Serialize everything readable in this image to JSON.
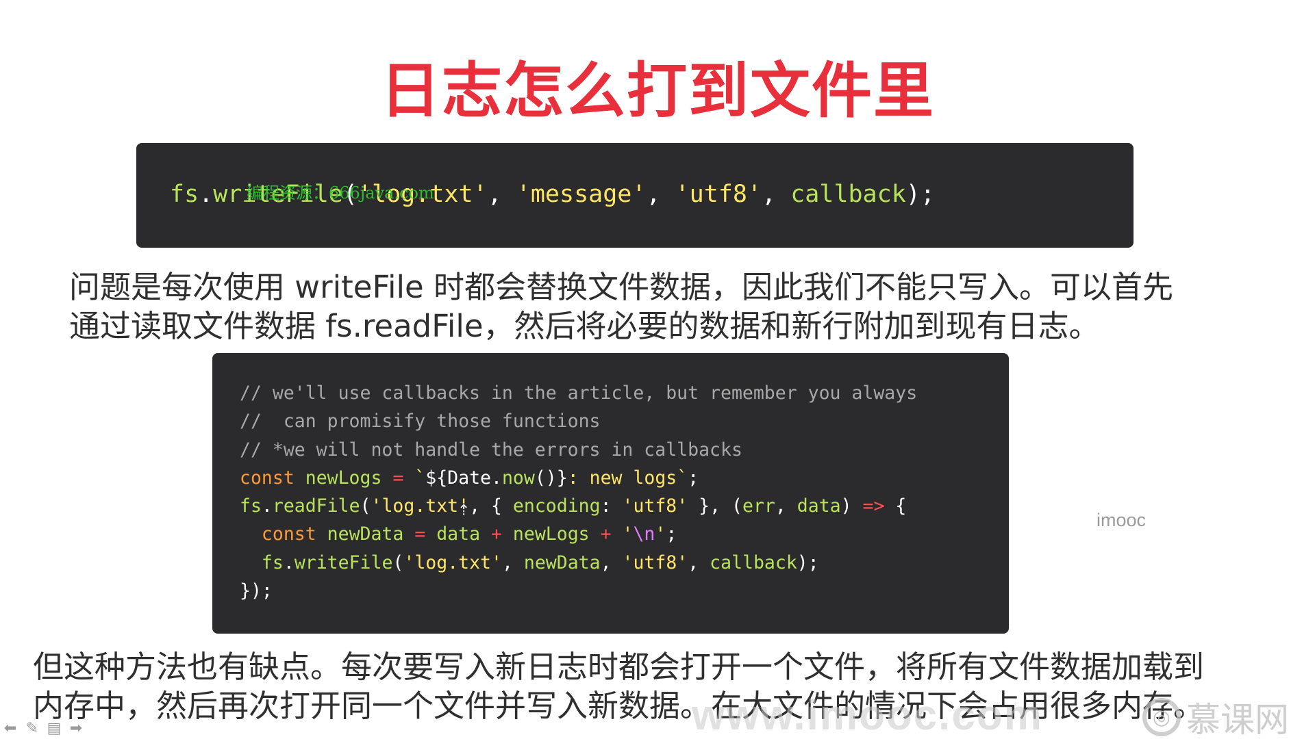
{
  "slide": {
    "title": "日志怎么打到文件里",
    "title_color": "#e8303c",
    "paragraph1": [
      "问题是每次使用 writeFile 时都会替换文件数据，因此我们不能只写入。可以首先",
      "通过读取文件数据 fs.readFile，然后将必要的数据和新行附加到现有日志。"
    ],
    "paragraph2": [
      "但这种方法也有缺点。每次要写入新日志时都会打开一个文件，将所有文件数据加载到",
      "内存中，然后再次打开同一个文件并写入新数据。在大文件的情况下会占用很多内存。"
    ],
    "imooc_mark": "imooc",
    "green_watermark": "编程资源：666java.com",
    "bottom_watermark": "www.imooc.com",
    "brand_watermark": "慕课网"
  },
  "colors": {
    "code_bg": "#2b2b2d",
    "plain": "#ffffff",
    "func": "#b8e35a",
    "string": "#ffe566",
    "keyword": "#ff9933",
    "operator": "#ff4d4d",
    "comment": "#a8a8a8",
    "escape": "#e07bff"
  },
  "code1": [
    [
      [
        "func",
        "fs"
      ],
      [
        "plain",
        "."
      ],
      [
        "func",
        "writeFile"
      ],
      [
        "plain",
        "("
      ],
      [
        "string",
        "'log.txt'"
      ],
      [
        "plain",
        ", "
      ],
      [
        "string",
        "'message'"
      ],
      [
        "plain",
        ", "
      ],
      [
        "string",
        "'utf8'"
      ],
      [
        "plain",
        ", "
      ],
      [
        "func",
        "callback"
      ],
      [
        "plain",
        ");"
      ]
    ]
  ],
  "code2": [
    [
      [
        "comment",
        "// we'll use callbacks in the article, but remember you always"
      ]
    ],
    [
      [
        "comment",
        "//  can promisify those functions"
      ]
    ],
    [
      [
        "comment",
        "// *we will not handle the errors in callbacks"
      ]
    ],
    [
      [
        "keyword",
        "const "
      ],
      [
        "func",
        "newLogs"
      ],
      [
        "operator",
        " = "
      ],
      [
        "string",
        "`"
      ],
      [
        "plain",
        "${Date."
      ],
      [
        "func",
        "now"
      ],
      [
        "plain",
        "()}"
      ],
      [
        "string",
        ": new logs`"
      ],
      [
        "plain",
        ";"
      ]
    ],
    [
      [
        "func",
        "fs"
      ],
      [
        "plain",
        "."
      ],
      [
        "func",
        "readFile"
      ],
      [
        "plain",
        "("
      ],
      [
        "string",
        "'log.txt'"
      ],
      [
        "plain",
        ", { "
      ],
      [
        "func",
        "encoding"
      ],
      [
        "plain",
        ": "
      ],
      [
        "string",
        "'utf8'"
      ],
      [
        "plain",
        " }, ("
      ],
      [
        "func",
        "err"
      ],
      [
        "plain",
        ", "
      ],
      [
        "func",
        "data"
      ],
      [
        "plain",
        ") "
      ],
      [
        "operator",
        "=>"
      ],
      [
        "plain",
        " {"
      ]
    ],
    [
      [
        "plain",
        "  "
      ],
      [
        "keyword",
        "const "
      ],
      [
        "func",
        "newData"
      ],
      [
        "operator",
        " = "
      ],
      [
        "func",
        "data"
      ],
      [
        "operator",
        " + "
      ],
      [
        "func",
        "newLogs"
      ],
      [
        "operator",
        " + "
      ],
      [
        "string",
        "'"
      ],
      [
        "escape",
        "\\n"
      ],
      [
        "string",
        "'"
      ],
      [
        "plain",
        ";"
      ]
    ],
    [
      [
        "plain",
        "  "
      ],
      [
        "func",
        "fs"
      ],
      [
        "plain",
        "."
      ],
      [
        "func",
        "writeFile"
      ],
      [
        "plain",
        "("
      ],
      [
        "string",
        "'log.txt'"
      ],
      [
        "plain",
        ", "
      ],
      [
        "func",
        "newData"
      ],
      [
        "plain",
        ", "
      ],
      [
        "string",
        "'utf8'"
      ],
      [
        "plain",
        ", "
      ],
      [
        "func",
        "callback"
      ],
      [
        "plain",
        ");"
      ]
    ],
    [
      [
        "plain",
        "});"
      ]
    ]
  ],
  "controls": [
    {
      "name": "prev-arrow-icon",
      "glyph": "⬅"
    },
    {
      "name": "pen-icon",
      "glyph": "✎"
    },
    {
      "name": "menu-icon",
      "glyph": "▤"
    },
    {
      "name": "next-arrow-icon",
      "glyph": "➡"
    }
  ]
}
